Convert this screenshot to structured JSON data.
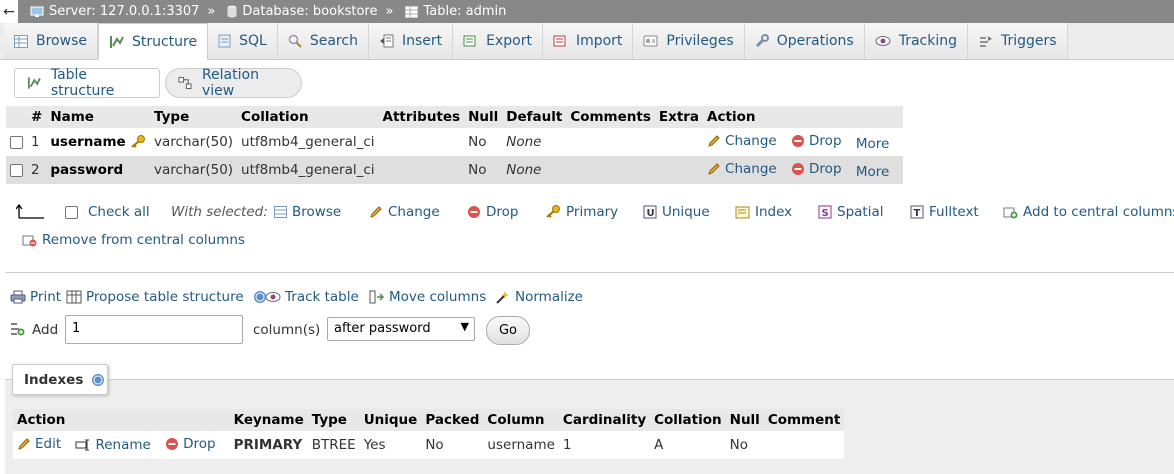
{
  "breadcrumb": {
    "back": "←",
    "server": "Server: 127.0.0.1:3307",
    "database": "Database: bookstore",
    "table": "Table: admin",
    "separator": "»"
  },
  "tabs": [
    {
      "label": "Browse",
      "icon": "browse-icon"
    },
    {
      "label": "Structure",
      "icon": "structure-icon",
      "active": true
    },
    {
      "label": "SQL",
      "icon": "sql-icon"
    },
    {
      "label": "Search",
      "icon": "search-icon"
    },
    {
      "label": "Insert",
      "icon": "insert-icon"
    },
    {
      "label": "Export",
      "icon": "export-icon"
    },
    {
      "label": "Import",
      "icon": "import-icon"
    },
    {
      "label": "Privileges",
      "icon": "privileges-icon"
    },
    {
      "label": "Operations",
      "icon": "operations-icon"
    },
    {
      "label": "Tracking",
      "icon": "tracking-icon"
    },
    {
      "label": "Triggers",
      "icon": "triggers-icon"
    }
  ],
  "subtabs": {
    "table_structure": "Table structure",
    "relation_view": "Relation view"
  },
  "structure": {
    "headers": [
      "#",
      "Name",
      "Type",
      "Collation",
      "Attributes",
      "Null",
      "Default",
      "Comments",
      "Extra",
      "Action"
    ],
    "rows": [
      {
        "num": "1",
        "name": "username",
        "type": "varchar(50)",
        "collation": "utf8mb4_general_ci",
        "attributes": "",
        "null": "No",
        "default": "None",
        "comments": "",
        "extra": ""
      },
      {
        "num": "2",
        "name": "password",
        "type": "varchar(50)",
        "collation": "utf8mb4_general_ci",
        "attributes": "",
        "null": "No",
        "default": "None",
        "comments": "",
        "extra": ""
      }
    ],
    "actions": {
      "change": "Change",
      "drop": "Drop",
      "more": "More"
    }
  },
  "with_selected": {
    "check_all": "Check all",
    "label": "With selected:",
    "browse": "Browse",
    "change": "Change",
    "drop": "Drop",
    "primary": "Primary",
    "unique": "Unique",
    "index": "Index",
    "spatial": "Spatial",
    "fulltext": "Fulltext",
    "add_central": "Add to central columns",
    "remove_central": "Remove from central columns"
  },
  "tools": {
    "print": "Print",
    "propose": "Propose table structure",
    "track": "Track table",
    "move": "Move columns",
    "normalize": "Normalize"
  },
  "add_columns": {
    "label": "Add",
    "count": "1",
    "unit": "column(s)",
    "position": "after password",
    "go": "Go"
  },
  "indexes": {
    "title": "Indexes",
    "headers": [
      "Action",
      "Keyname",
      "Type",
      "Unique",
      "Packed",
      "Column",
      "Cardinality",
      "Collation",
      "Null",
      "Comment"
    ],
    "rows": [
      {
        "edit": "Edit",
        "rename": "Rename",
        "drop": "Drop",
        "keyname": "PRIMARY",
        "type": "BTREE",
        "unique": "Yes",
        "packed": "No",
        "column": "username",
        "cardinality": "1",
        "collation": "A",
        "null": "No",
        "comment": ""
      }
    ]
  },
  "colors": {
    "link": "#235a81",
    "topbar": "#888888",
    "drop": "#d9534f",
    "change": "#d8a020"
  }
}
